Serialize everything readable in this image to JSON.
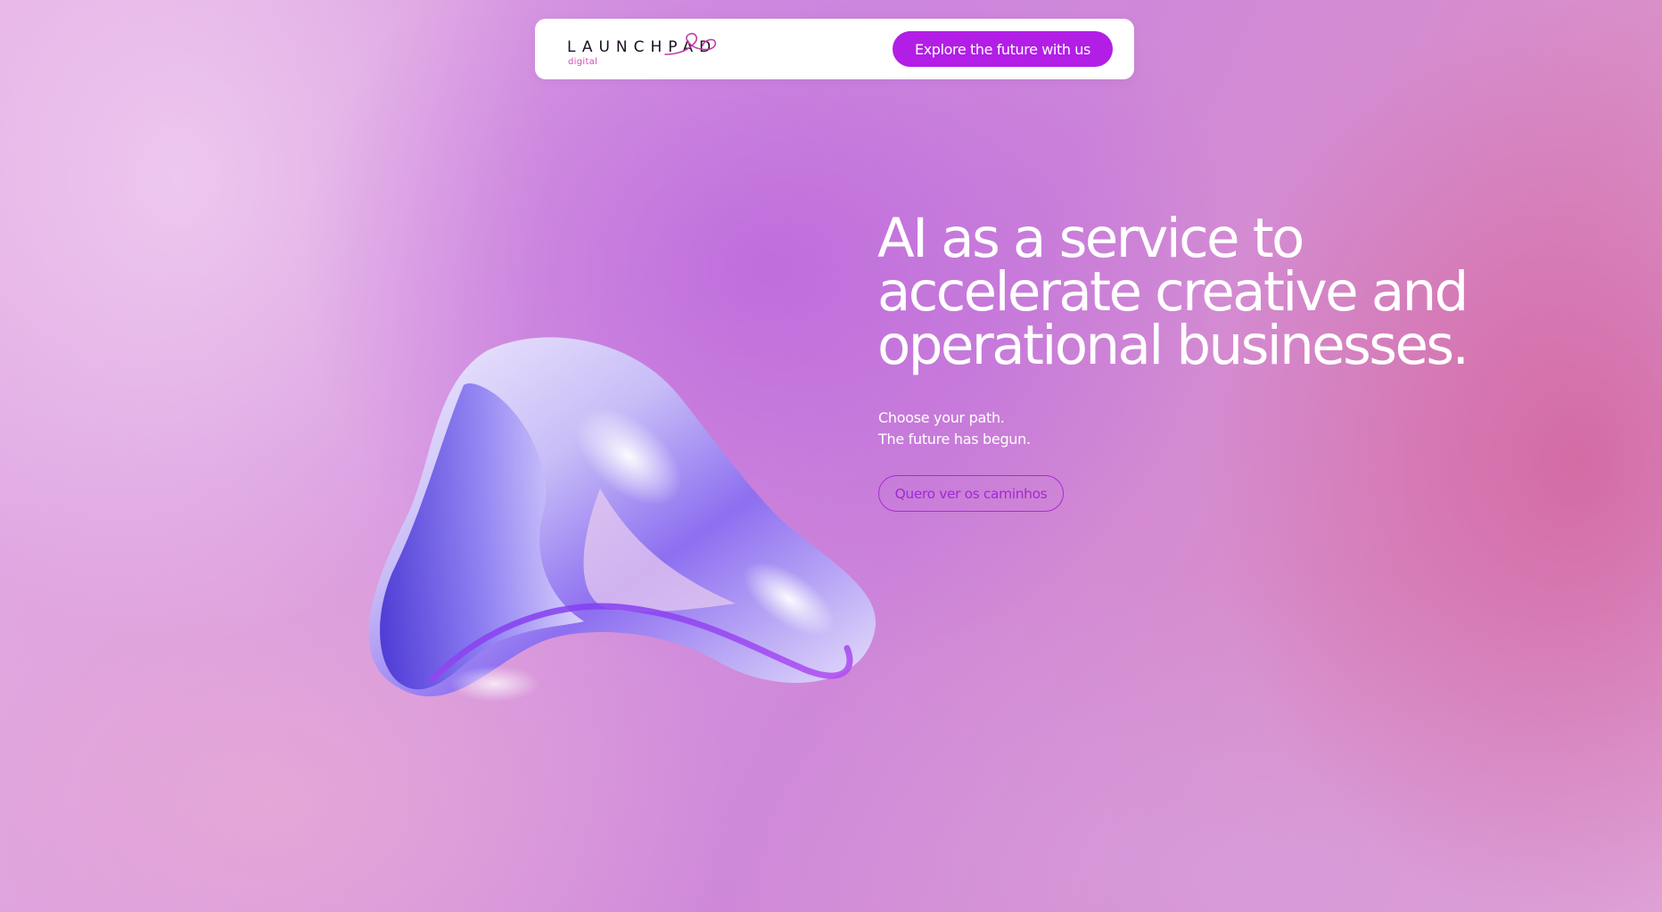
{
  "header": {
    "logo": {
      "wordmark": "LAUNCHPAD",
      "sub": "digital",
      "icon": "launchpad-swirl-logo"
    },
    "cta_label": "Explore the future with us"
  },
  "hero": {
    "title": "AI as a service to accelerate creative and operational businesses.",
    "subtitle_line1": "Choose your path.",
    "subtitle_line2": "The future has begun.",
    "button_label": "Quero ver os caminhos"
  },
  "colors": {
    "accent": "#b21ee6",
    "outline_button": "#a62bd8",
    "logo_accent": "#d44bb6",
    "hero_text": "#ffffff"
  }
}
